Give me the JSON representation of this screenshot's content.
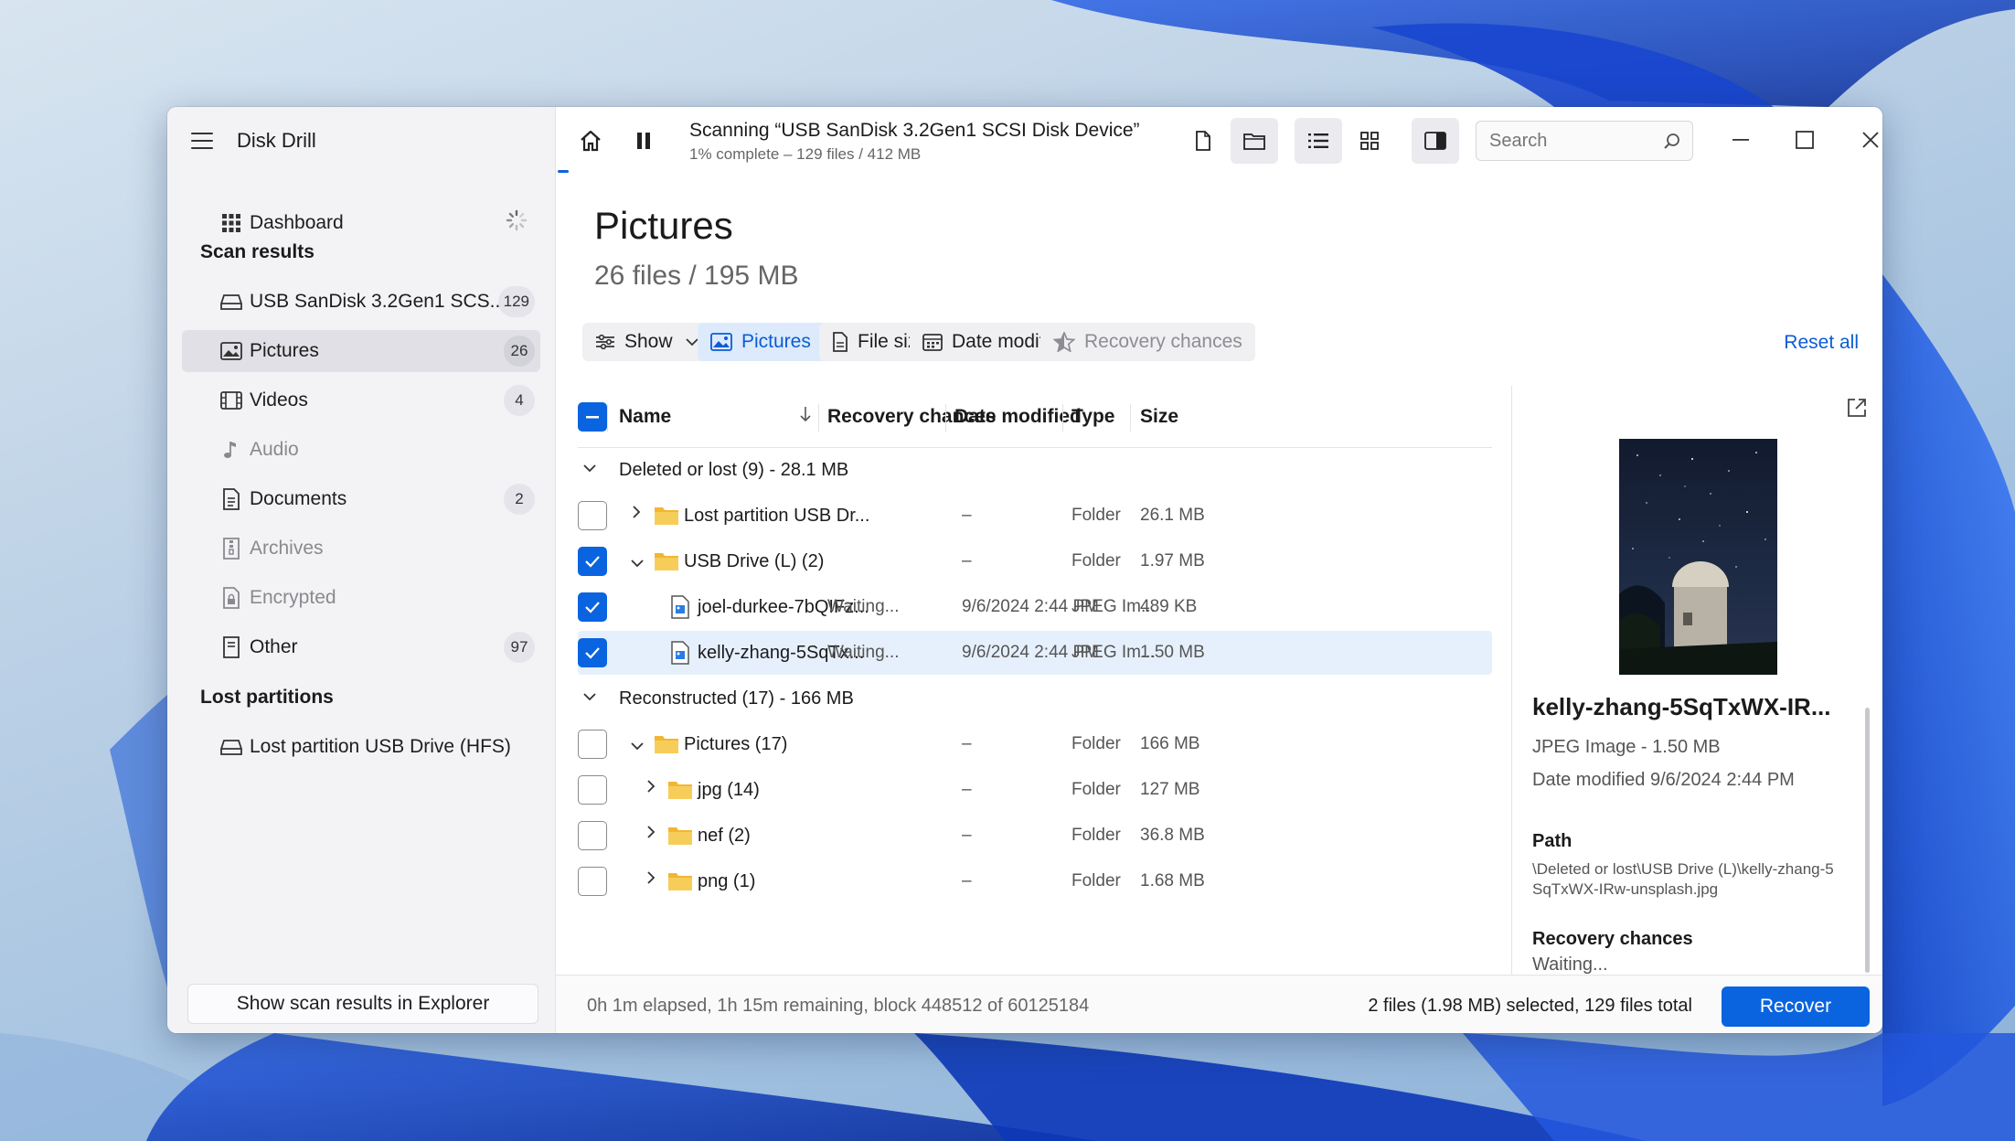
{
  "app": {
    "title": "Disk Drill"
  },
  "sidebar": {
    "dashboard": "Dashboard",
    "scan_results_header": "Scan results",
    "lost_partitions_header": "Lost partitions",
    "items": [
      {
        "label": "USB  SanDisk 3.2Gen1 SCS...",
        "count": "129",
        "icon": "drive-icon"
      },
      {
        "label": "Pictures",
        "count": "26",
        "icon": "picture-icon"
      },
      {
        "label": "Videos",
        "count": "4",
        "icon": "film-icon"
      },
      {
        "label": "Audio",
        "count": "",
        "icon": "music-note-icon"
      },
      {
        "label": "Documents",
        "count": "2",
        "icon": "document-icon"
      },
      {
        "label": "Archives",
        "count": "",
        "icon": "archive-icon"
      },
      {
        "label": "Encrypted",
        "count": "",
        "icon": "lock-file-icon"
      },
      {
        "label": "Other",
        "count": "97",
        "icon": "file-icon"
      }
    ],
    "lost_partition": "Lost partition USB Drive (HFS)",
    "show_in_explorer": "Show scan results in Explorer"
  },
  "toolbar": {
    "scan_title": "Scanning “USB  SanDisk 3.2Gen1 SCSI Disk Device”",
    "scan_subtitle": "1% complete – 129 files / 412 MB",
    "search_placeholder": "Search"
  },
  "page": {
    "title": "Pictures",
    "subtitle": "26 files / 195 MB"
  },
  "filters": {
    "show": "Show",
    "pictures": "Pictures",
    "file_size": "File size",
    "date_modified": "Date modified",
    "recovery_chances": "Recovery chances",
    "reset_all": "Reset all"
  },
  "columns": {
    "name": "Name",
    "recovery": "Recovery chances",
    "date": "Date modified",
    "type": "Type",
    "size": "Size"
  },
  "groups": [
    {
      "label": "Deleted or lost (9) - 28.1 MB"
    },
    {
      "label": "Reconstructed (17) - 166 MB"
    }
  ],
  "rows": [
    {
      "name": "Lost partition USB Dr...",
      "recovery": "",
      "date": "–",
      "type": "Folder",
      "size": "26.1 MB",
      "checked": false
    },
    {
      "name": "USB Drive (L) (2)",
      "recovery": "",
      "date": "–",
      "type": "Folder",
      "size": "1.97 MB",
      "checked": true
    },
    {
      "name": "joel-durkee-7bQIFz...",
      "recovery": "Waiting...",
      "date": "9/6/2024 2:44 PM",
      "type": "JPEG Im...",
      "size": "489 KB",
      "checked": true
    },
    {
      "name": "kelly-zhang-5SqTx...",
      "recovery": "Waiting...",
      "date": "9/6/2024 2:44 PM",
      "type": "JPEG Im...",
      "size": "1.50 MB",
      "checked": true
    },
    {
      "name": "Pictures (17)",
      "recovery": "",
      "date": "–",
      "type": "Folder",
      "size": "166 MB",
      "checked": false
    },
    {
      "name": "jpg (14)",
      "recovery": "",
      "date": "–",
      "type": "Folder",
      "size": "127 MB",
      "checked": false
    },
    {
      "name": "nef (2)",
      "recovery": "",
      "date": "–",
      "type": "Folder",
      "size": "36.8 MB",
      "checked": false
    },
    {
      "name": "png (1)",
      "recovery": "",
      "date": "–",
      "type": "Folder",
      "size": "1.68 MB",
      "checked": false
    }
  ],
  "preview": {
    "name": "kelly-zhang-5SqTxWX-IR...",
    "type_size": "JPEG Image - 1.50 MB",
    "date": "Date modified 9/6/2024 2:44 PM",
    "path_label": "Path",
    "path": "\\Deleted or lost\\USB Drive (L)\\kelly-zhang-5SqTxWX-IRw-unsplash.jpg",
    "recovery_label": "Recovery chances",
    "recovery_value": "Waiting..."
  },
  "status": {
    "left": "0h 1m elapsed, 1h 15m remaining, block 448512 of 60125184",
    "right": "2 files (1.98 MB) selected, 129 files total",
    "recover": "Recover"
  },
  "colors": {
    "accent": "#0a64e0",
    "selection": "#e6f0fd",
    "folder": "#f5c242"
  }
}
